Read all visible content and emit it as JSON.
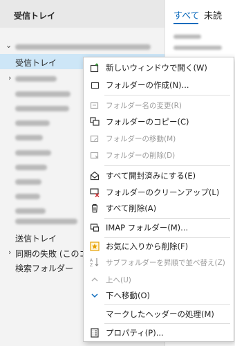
{
  "folder_pane": {
    "header": "受信トレイ",
    "selected_folder": "受信トレイ",
    "bottom_folders": [
      {
        "label": "送信トレイ",
        "chevron": ""
      },
      {
        "label": "同期の失敗 (このコ",
        "chevron": "›"
      },
      {
        "label": "検索フォルダー",
        "chevron": ""
      }
    ]
  },
  "message_list": {
    "tabs": [
      "すべて",
      "未読"
    ]
  },
  "context_menu": {
    "items": [
      {
        "label": "新しいウィンドウで開く(W)",
        "icon": "new-window-icon",
        "enabled": true
      },
      {
        "label": "フォルダーの作成(N)...",
        "icon": "new-folder-icon",
        "enabled": true
      },
      {
        "separator": true
      },
      {
        "label": "フォルダー名の変更(R)",
        "icon": "rename-folder-icon",
        "enabled": false
      },
      {
        "label": "フォルダーのコピー(C)",
        "icon": "copy-folder-icon",
        "enabled": true
      },
      {
        "label": "フォルダーの移動(M)",
        "icon": "move-folder-icon",
        "enabled": false
      },
      {
        "label": "フォルダーの削除(D)",
        "icon": "delete-folder-icon",
        "enabled": false
      },
      {
        "separator": true
      },
      {
        "label": "すべて開封済みにする(E)",
        "icon": "mark-all-read-icon",
        "enabled": true
      },
      {
        "label": "フォルダーのクリーンアップ(L)",
        "icon": "cleanup-folder-icon",
        "enabled": true
      },
      {
        "label": "すべて削除(A)",
        "icon": "delete-all-icon",
        "enabled": true
      },
      {
        "separator": true
      },
      {
        "label": "IMAP フォルダー(M)...",
        "icon": "imap-folder-icon",
        "enabled": true
      },
      {
        "separator": true
      },
      {
        "label": "お気に入りから削除(F)",
        "icon": "favorite-remove-icon",
        "enabled": true
      },
      {
        "label": "サブフォルダーを昇順で並べ替え(Z)",
        "icon": "sort-az-icon",
        "enabled": false
      },
      {
        "label": "上へ(U)",
        "icon": "arrow-up-icon",
        "enabled": false
      },
      {
        "label": "下へ移動(O)",
        "icon": "arrow-down-icon",
        "enabled": true
      },
      {
        "separator": true
      },
      {
        "label": "マークしたヘッダーの処理(M)",
        "icon": "",
        "enabled": true
      },
      {
        "separator": true
      },
      {
        "label": "プロパティ(P)...",
        "icon": "properties-icon",
        "enabled": true
      }
    ]
  },
  "colors": {
    "accent": "#0f6cbd",
    "selection": "#cde6f7",
    "pane_bg": "#f3f3f3",
    "favorite_icon": "#e6a000",
    "cleanup_x": "#d13438"
  }
}
